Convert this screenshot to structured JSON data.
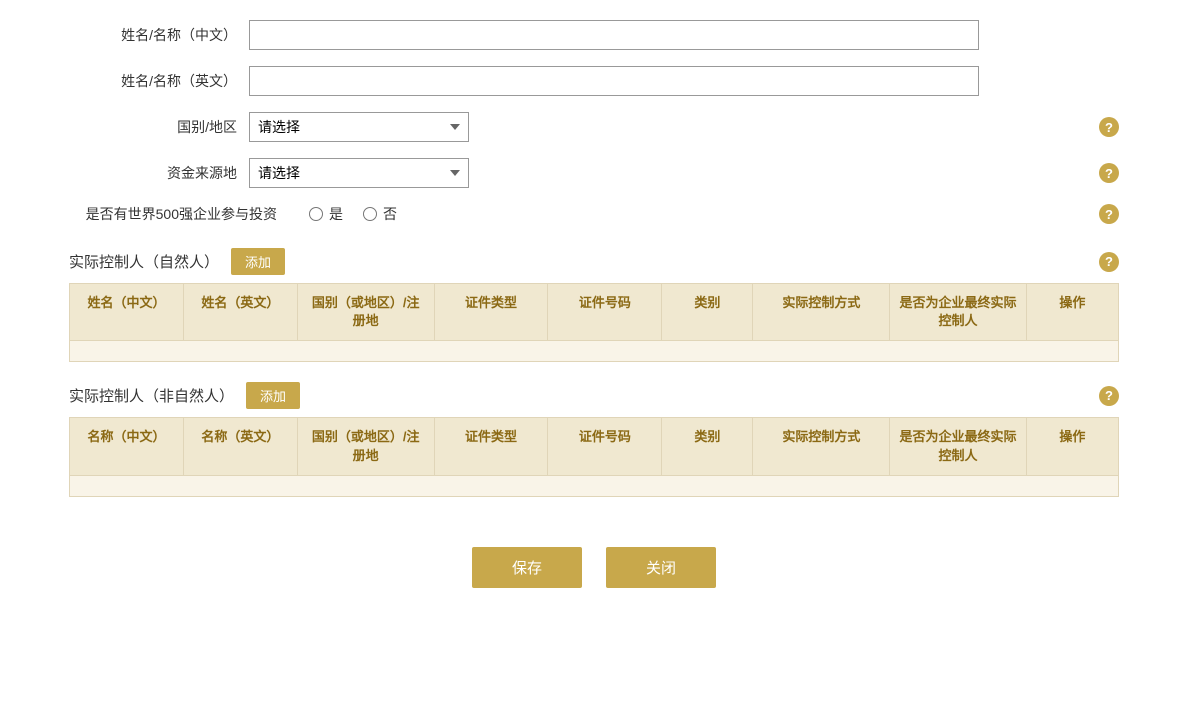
{
  "form": {
    "name_cn_label": "姓名/名称（中文）",
    "name_en_label": "姓名/名称（英文）",
    "country_label": "国别/地区",
    "fund_source_label": "资金来源地",
    "world500_label": "是否有世界500强企业参与投资",
    "country_placeholder": "请选择",
    "fund_source_placeholder": "请选择",
    "yes_label": "是",
    "no_label": "否",
    "name_cn_value": "",
    "name_en_value": ""
  },
  "section_natural": {
    "title": "实际控制人（自然人）",
    "add_label": "添加",
    "columns": [
      "姓名（中文）",
      "姓名（英文）",
      "国别（或地区）/注册地",
      "证件类型",
      "证件号码",
      "类别",
      "实际控制方式",
      "是否为企业最终实际控制人",
      "操作"
    ]
  },
  "section_non_natural": {
    "title": "实际控制人（非自然人）",
    "add_label": "添加",
    "columns": [
      "名称（中文）",
      "名称（英文）",
      "国别（或地区）/注册地",
      "证件类型",
      "证件号码",
      "类别",
      "实际控制方式",
      "是否为企业最终实际控制人",
      "操作"
    ]
  },
  "buttons": {
    "save": "保存",
    "close": "关闭"
  },
  "help_icon": "?",
  "colors": {
    "accent": "#c8a84b",
    "table_header_bg": "#f0e8d0",
    "table_border": "#e0d5b8",
    "table_text": "#8b6914"
  }
}
